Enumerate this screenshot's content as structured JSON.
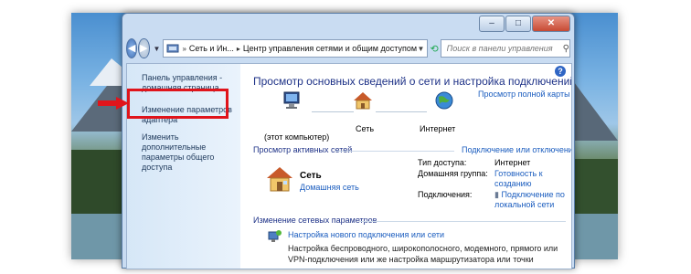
{
  "window": {
    "buttons": {
      "minimize": "–",
      "maximize": "□",
      "close": "✕"
    }
  },
  "nav": {
    "back": "◀",
    "forward": "▶",
    "address": {
      "part1": "Сеть и Ин...",
      "part2": "Центр управления сетями и общим доступом"
    },
    "search_placeholder": "Поиск в панели управления"
  },
  "sidebar": {
    "links": [
      "Панель управления - домашняя страница",
      "Изменение параметров адаптера",
      "Изменить дополнительные параметры общего доступа"
    ]
  },
  "main": {
    "help": "?",
    "title": "Просмотр основных сведений о сети и настройка подключений",
    "map_link": "Просмотр полной карты",
    "nodes": {
      "pc": "(этот компьютер)",
      "network": "Сеть",
      "internet": "Интернет"
    },
    "active_title": "Просмотр активных сетей",
    "connect_link": "Подключение или отключение",
    "network_name": "Сеть",
    "network_type": "Домашняя сеть",
    "props": {
      "access_label": "Тип доступа:",
      "access_value": "Интернет",
      "group_label": "Домашняя группа:",
      "group_value": "Готовность к созданию",
      "connections_label": "Подключения:",
      "connections_value": "Подключение по локальной сети"
    },
    "change_title": "Изменение сетевых параметров",
    "setup_link": "Настройка нового подключения или сети",
    "setup_desc": "Настройка беспроводного, широкополосного, модемного, прямого или VPN-подключения или же настройка маршрутизатора или точки доступа."
  },
  "colors": {
    "highlight": "#e0141b",
    "link": "#1b5dbf",
    "title": "#1e3287"
  }
}
